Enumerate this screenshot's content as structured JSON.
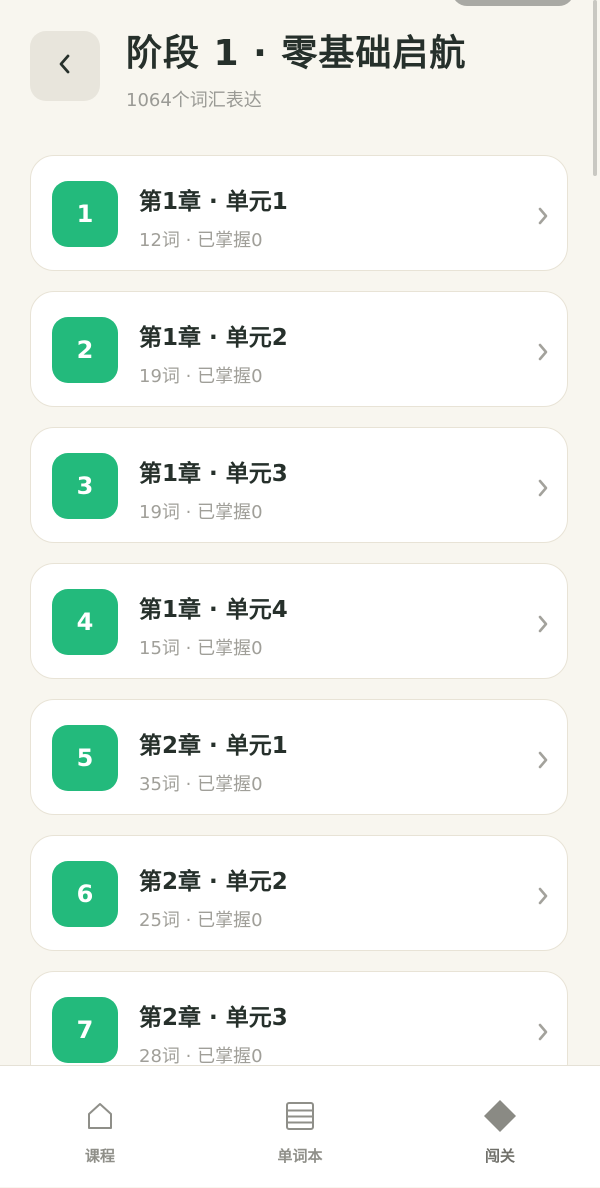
{
  "header": {
    "title": "阶段 1 · 零基础启航",
    "subtitle": "1064个词汇表达",
    "back_icon": "chevron-left-icon"
  },
  "colors": {
    "background": "#f8f6ef",
    "accent": "#23ba7c",
    "card_border": "#e8e3d6",
    "title_text": "#26302b",
    "muted_text": "#a09f99"
  },
  "units": [
    {
      "number": "1",
      "title": "第1章 · 单元1",
      "meta": "12词 · 已掌握0"
    },
    {
      "number": "2",
      "title": "第1章 · 单元2",
      "meta": "19词 · 已掌握0"
    },
    {
      "number": "3",
      "title": "第1章 · 单元3",
      "meta": "19词 · 已掌握0"
    },
    {
      "number": "4",
      "title": "第1章 · 单元4",
      "meta": "15词 · 已掌握0"
    },
    {
      "number": "5",
      "title": "第2章 · 单元1",
      "meta": "35词 · 已掌握0"
    },
    {
      "number": "6",
      "title": "第2章 · 单元2",
      "meta": "25词 · 已掌握0"
    },
    {
      "number": "7",
      "title": "第2章 · 单元3",
      "meta": "28词 · 已掌握0"
    }
  ],
  "bottom_nav": {
    "items": [
      {
        "label": "课程",
        "icon": "home-icon"
      },
      {
        "label": "单词本",
        "icon": "list-icon"
      },
      {
        "label": "闯关",
        "icon": "diamond-icon"
      }
    ],
    "active_index": 2
  }
}
